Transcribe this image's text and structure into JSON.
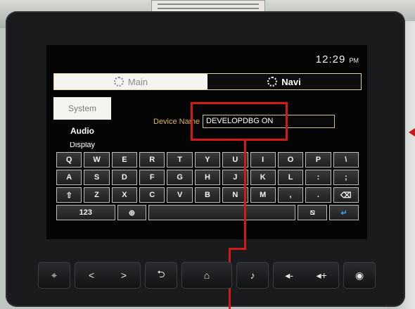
{
  "clock": {
    "time": "12:29",
    "ampm": "PM"
  },
  "tabs": [
    {
      "label": "Main"
    },
    {
      "label": "Navi"
    }
  ],
  "sidebar": {
    "items": [
      {
        "label": "System"
      },
      {
        "label": "Audio"
      },
      {
        "label": "Display"
      }
    ]
  },
  "device": {
    "label": "Device Name",
    "value": "DEVELOPDBG ON"
  },
  "keyboard": {
    "rows": [
      [
        "Q",
        "W",
        "E",
        "R",
        "T",
        "Y",
        "U",
        "I",
        "O",
        "P",
        "\\"
      ],
      [
        "A",
        "S",
        "D",
        "F",
        "G",
        "H",
        "J",
        "K",
        "L",
        ":",
        ";"
      ],
      [
        "⇧",
        "Z",
        "X",
        "C",
        "V",
        "B",
        "N",
        "M",
        ",",
        ".",
        "⌫"
      ],
      [
        "123",
        "⊕",
        "",
        "⧅",
        "↵"
      ]
    ],
    "icons": {
      "shift": "shift-icon",
      "backspace": "backspace-icon",
      "globe": "globe-icon",
      "hide": "hide-keyboard-icon",
      "enter": "enter-icon"
    }
  },
  "hardware_buttons": [
    {
      "glyph": "⌖",
      "icon": "location-icon"
    },
    {
      "glyph": "<",
      "icon": "previous-icon"
    },
    {
      "glyph": ">",
      "icon": "next-icon"
    },
    {
      "glyph": "⮌",
      "icon": "back-icon"
    },
    {
      "glyph": "⌂",
      "icon": "home-icon"
    },
    {
      "glyph": "♪",
      "icon": "media-icon"
    },
    {
      "glyph": "◂-",
      "icon": "volume-down-icon"
    },
    {
      "glyph": "◂+",
      "icon": "volume-up-icon"
    },
    {
      "glyph": "◉",
      "icon": "navigation-icon"
    }
  ],
  "colors": {
    "highlight": "#d21a1a",
    "device_label": "#d9b25a",
    "enter_key": "#3fa0ff"
  }
}
